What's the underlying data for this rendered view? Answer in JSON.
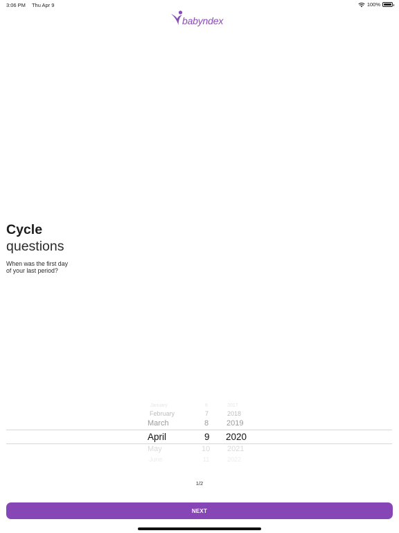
{
  "status_bar": {
    "time": "3:06 PM",
    "date": "Thu Apr 9",
    "battery_text": "100%",
    "battery_level": 1.0,
    "icons": [
      "wifi-icon",
      "battery-icon"
    ]
  },
  "header": {
    "logo_text": "babyndex"
  },
  "content": {
    "title_bold": "Cycle",
    "title_light": "questions",
    "question_line1": "When was the first day",
    "question_line2": "of your last period?"
  },
  "date_picker": {
    "months": [
      "January",
      "February",
      "March",
      "April",
      "May",
      "June"
    ],
    "days": [
      "6",
      "7",
      "8",
      "9",
      "10",
      "11"
    ],
    "years": [
      "2017",
      "2018",
      "2019",
      "2020",
      "2021",
      "2022"
    ],
    "selected": {
      "month": "April",
      "day": "9",
      "year": "2020"
    }
  },
  "pagination": {
    "indicator": "1/2"
  },
  "footer": {
    "next_label": "NEXT"
  },
  "colors": {
    "accent": "#8646b5",
    "logo": "#8a4ab7",
    "text": "#1c1c1e",
    "picker_line": "#d8d8d8"
  }
}
